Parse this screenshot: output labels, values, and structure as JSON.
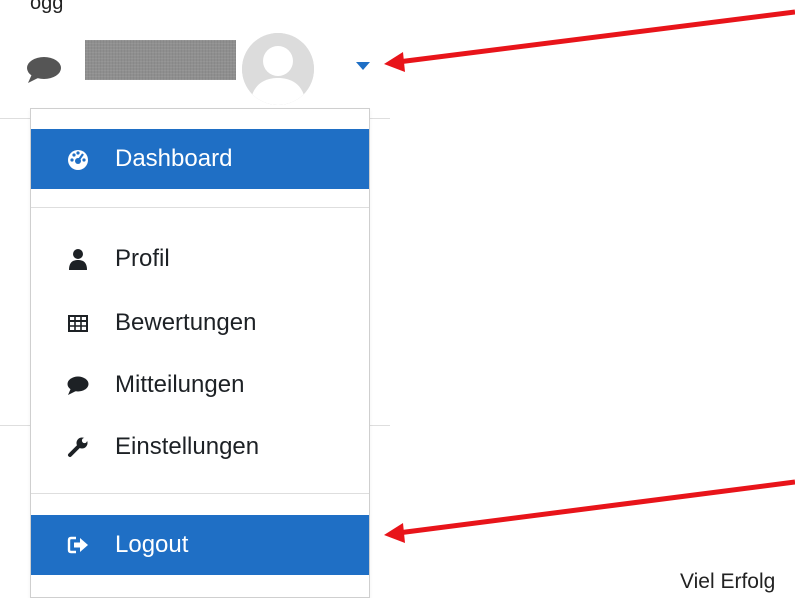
{
  "header": {
    "top_text": "ogg"
  },
  "user_menu": {
    "chat_icon": "chat-bubble-icon",
    "username_redacted": true,
    "avatar_icon": "default-user-avatar",
    "toggle_icon": "caret-down-icon"
  },
  "menu": {
    "items": [
      {
        "label": "Dashboard",
        "icon": "dashboard-icon",
        "active": true
      },
      {
        "label": "Profil",
        "icon": "user-icon",
        "active": false
      },
      {
        "label": "Bewertungen",
        "icon": "table-icon",
        "active": false
      },
      {
        "label": "Mitteilungen",
        "icon": "chat-bubble-icon",
        "active": false
      },
      {
        "label": "Einstellungen",
        "icon": "wrench-icon",
        "active": false
      },
      {
        "label": "Logout",
        "icon": "sign-out-icon",
        "active": true
      }
    ]
  },
  "annotations": {
    "arrow_color": "#e8141a",
    "accent_color": "#1f6fc5"
  },
  "footer": {
    "bottom_text": "Viel Erfolg"
  }
}
